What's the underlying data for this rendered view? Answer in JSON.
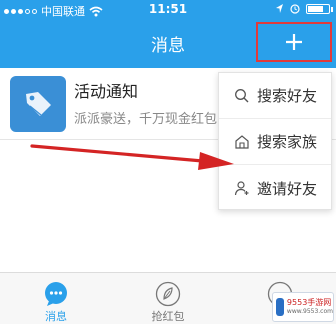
{
  "status_bar": {
    "carrier": "中国联通",
    "time": "11:51"
  },
  "header": {
    "title": "消息",
    "add_label": "+"
  },
  "messages": [
    {
      "title": "活动通知",
      "subtitle": "派派豪送，千万现金红包"
    }
  ],
  "menu": {
    "items": [
      {
        "label": "搜索好友",
        "icon": "search-icon"
      },
      {
        "label": "搜索家族",
        "icon": "house-icon"
      },
      {
        "label": "邀请好友",
        "icon": "user-plus-icon"
      }
    ]
  },
  "tabs": [
    {
      "label": "消息",
      "icon": "chat-bubble-icon",
      "active": true
    },
    {
      "label": "抢红包",
      "icon": "leaf-icon",
      "active": false
    }
  ],
  "watermark": {
    "name": "9553手游网",
    "url": "www.9553.com"
  },
  "colors": {
    "primary": "#2aa0ea",
    "highlight": "#e23a3a"
  }
}
